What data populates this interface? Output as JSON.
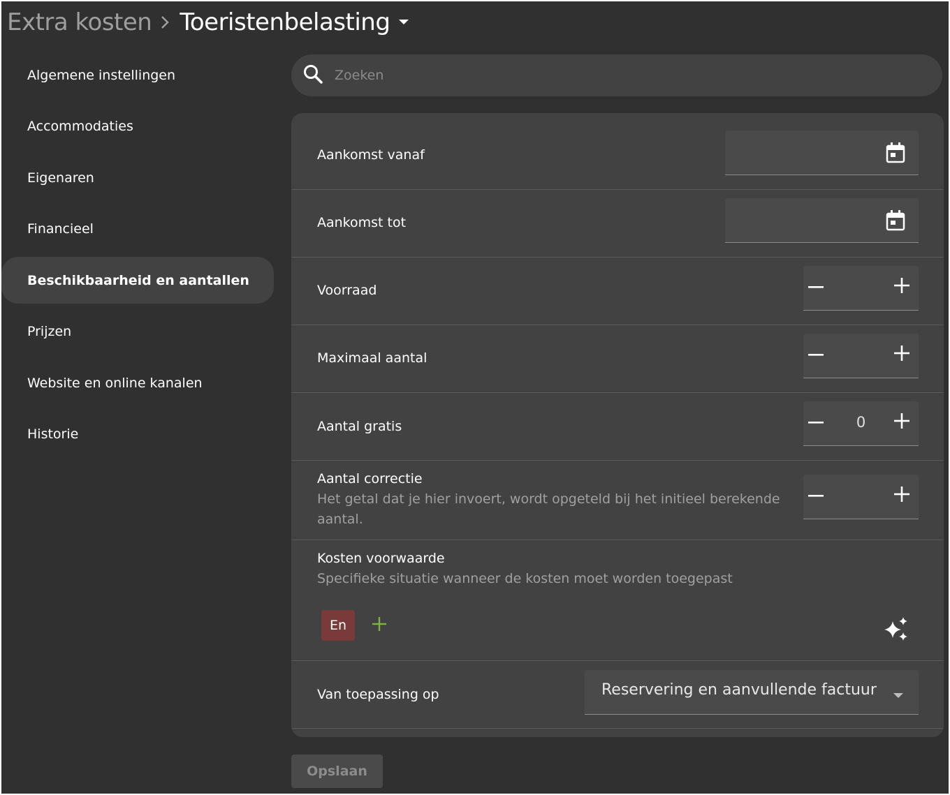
{
  "header": {
    "parent": "Extra kosten",
    "current": "Toeristenbelasting"
  },
  "sidebar": {
    "items": [
      {
        "label": "Algemene instellingen"
      },
      {
        "label": "Accommodaties"
      },
      {
        "label": "Eigenaren"
      },
      {
        "label": "Financieel"
      },
      {
        "label": "Beschikbaarheid en aantallen",
        "active": true
      },
      {
        "label": "Prijzen"
      },
      {
        "label": "Website en online kanalen"
      },
      {
        "label": "Historie"
      }
    ]
  },
  "search": {
    "placeholder": "Zoeken",
    "value": ""
  },
  "form": {
    "arrival_from": {
      "label": "Aankomst vanaf",
      "value": ""
    },
    "arrival_to": {
      "label": "Aankomst tot",
      "value": ""
    },
    "stock": {
      "label": "Voorraad",
      "value": ""
    },
    "max_count": {
      "label": "Maximaal aantal",
      "value": ""
    },
    "free_count": {
      "label": "Aantal gratis",
      "value": "0"
    },
    "correction": {
      "label": "Aantal correctie",
      "hint": "Het getal dat je hier invoert, wordt opgeteld bij het initieel berekende aantal.",
      "value": ""
    },
    "condition": {
      "label": "Kosten voorwaarde",
      "hint": "Specifieke situatie wanneer de kosten moet worden toegepast",
      "chip": "En"
    },
    "applies_to": {
      "label": "Van toepassing op",
      "value": "Reservering en aanvullende factuur"
    }
  },
  "actions": {
    "save": "Opslaan"
  },
  "colors": {
    "background": "#303030",
    "surface": "#424242",
    "chip": "#7b3a3a",
    "add_icon": "#7cb342"
  }
}
